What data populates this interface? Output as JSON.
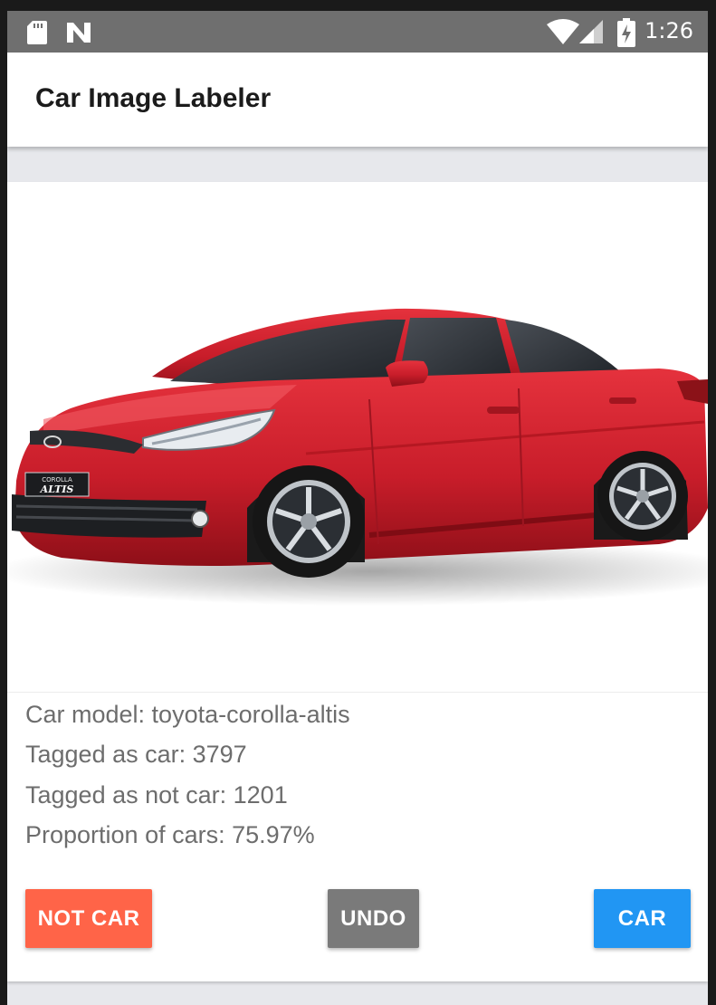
{
  "status_bar": {
    "time": "1:26",
    "icons": [
      "sd-card-icon",
      "n-notification-icon",
      "wifi-icon",
      "cell-signal-icon",
      "battery-charging-icon"
    ],
    "background": "#6f6f6f"
  },
  "app_bar": {
    "title": "Car Image Labeler"
  },
  "card": {
    "image": {
      "subject": "red-sedan-photo",
      "badge_line1": "COROLLA",
      "badge_line2": "ALTIS"
    },
    "info": {
      "model": "Car model: toyota-corolla-altis",
      "tagged_car": "Tagged as car: 3797",
      "tagged_not_car": "Tagged as not car: 1201",
      "proportion": "Proportion of cars: 75.97%"
    },
    "buttons": {
      "not_car": {
        "label": "NOT CAR",
        "color": "#ff6448"
      },
      "undo": {
        "label": "UNDO",
        "color": "#7a7a7a"
      },
      "car": {
        "label": "CAR",
        "color": "#2196f3"
      }
    }
  }
}
